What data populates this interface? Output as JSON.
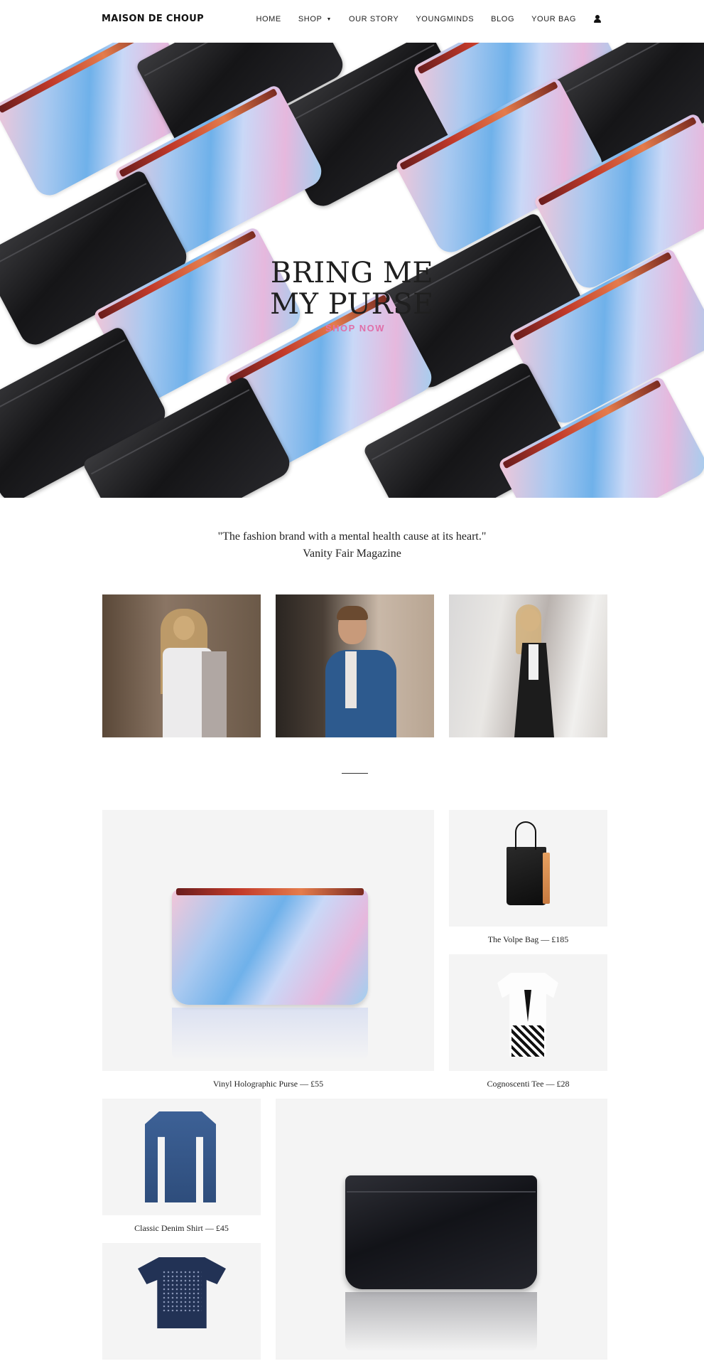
{
  "header": {
    "logo": "MAISON DE CHOUP",
    "nav": [
      {
        "label": "HOME"
      },
      {
        "label": "SHOP",
        "caret": "▼"
      },
      {
        "label": "OUR STORY"
      },
      {
        "label": "YOUNGMINDS"
      },
      {
        "label": "BLOG"
      },
      {
        "label": "YOUR BAG"
      }
    ],
    "account_icon": "user-icon"
  },
  "hero": {
    "title_line1": "BRING ME",
    "title_line2": "MY PURSE",
    "cta": "SHOP NOW",
    "slides": 5,
    "active_slide": 2,
    "cta_color": "#e06fa8"
  },
  "quote": {
    "text": "\"The fashion brand with a mental health cause at its heart.\"",
    "source": "Vanity Fair Magazine"
  },
  "products": [
    {
      "name": "Vinyl Holographic Purse",
      "sep": "—",
      "price": "£55"
    },
    {
      "name": "The Volpe Bag",
      "sep": "—",
      "price": "£185"
    },
    {
      "name": "Cognoscenti Tee",
      "sep": "—",
      "price": "£28"
    },
    {
      "name": "Classic Denim Shirt",
      "sep": "—",
      "price": "£45"
    }
  ]
}
